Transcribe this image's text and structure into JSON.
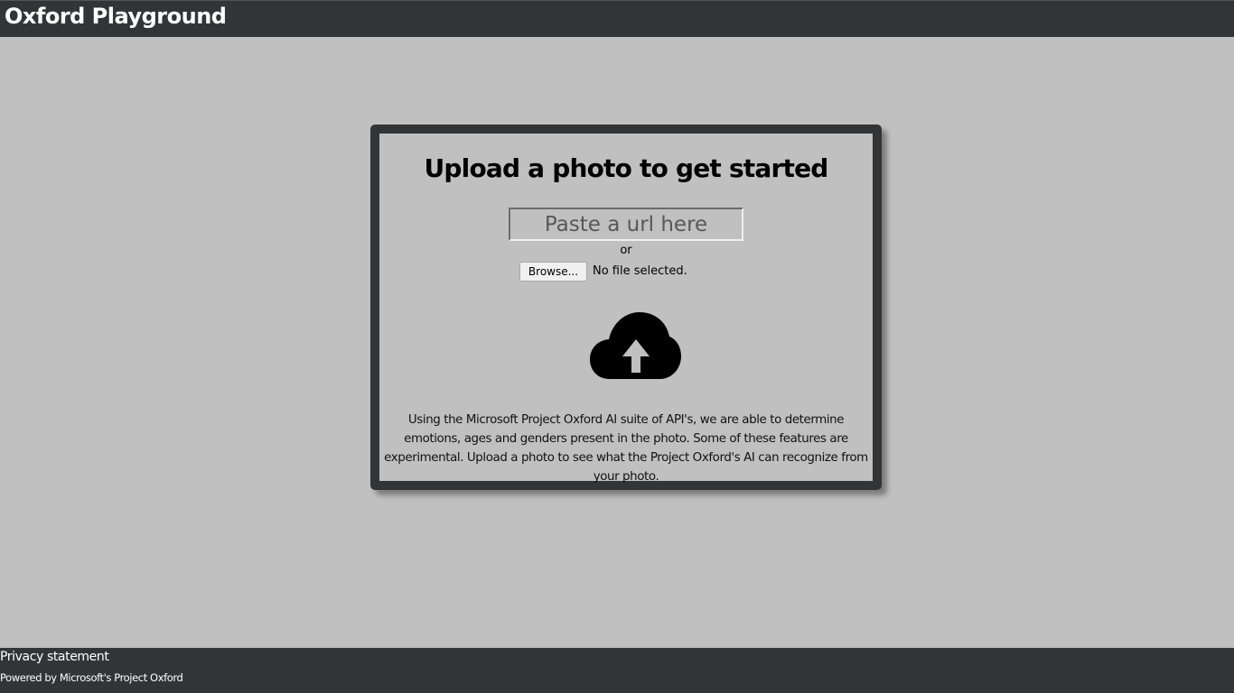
{
  "header": {
    "title": "Oxford Playground"
  },
  "upload": {
    "heading": "Upload a photo to get started",
    "url_placeholder": "Paste a url here",
    "or_label": "or",
    "browse_label": "Browse...",
    "file_status": "No file selected.",
    "upload_icon": "cloud-upload-icon",
    "description": "Using the Microsoft Project Oxford AI suite of API's, we are able to determine emotions, ages and genders present in the photo. Some of these features are experimental. Upload a photo to see what the Project Oxford's AI can recognize from your photo."
  },
  "footer": {
    "privacy_label": "Privacy statement",
    "powered_by": "Powered by Microsoft's Project Oxford"
  },
  "colors": {
    "bar_background": "#323537",
    "page_background": "#c0c0c0",
    "text_dark": "#000000",
    "text_light": "#ffffff"
  }
}
